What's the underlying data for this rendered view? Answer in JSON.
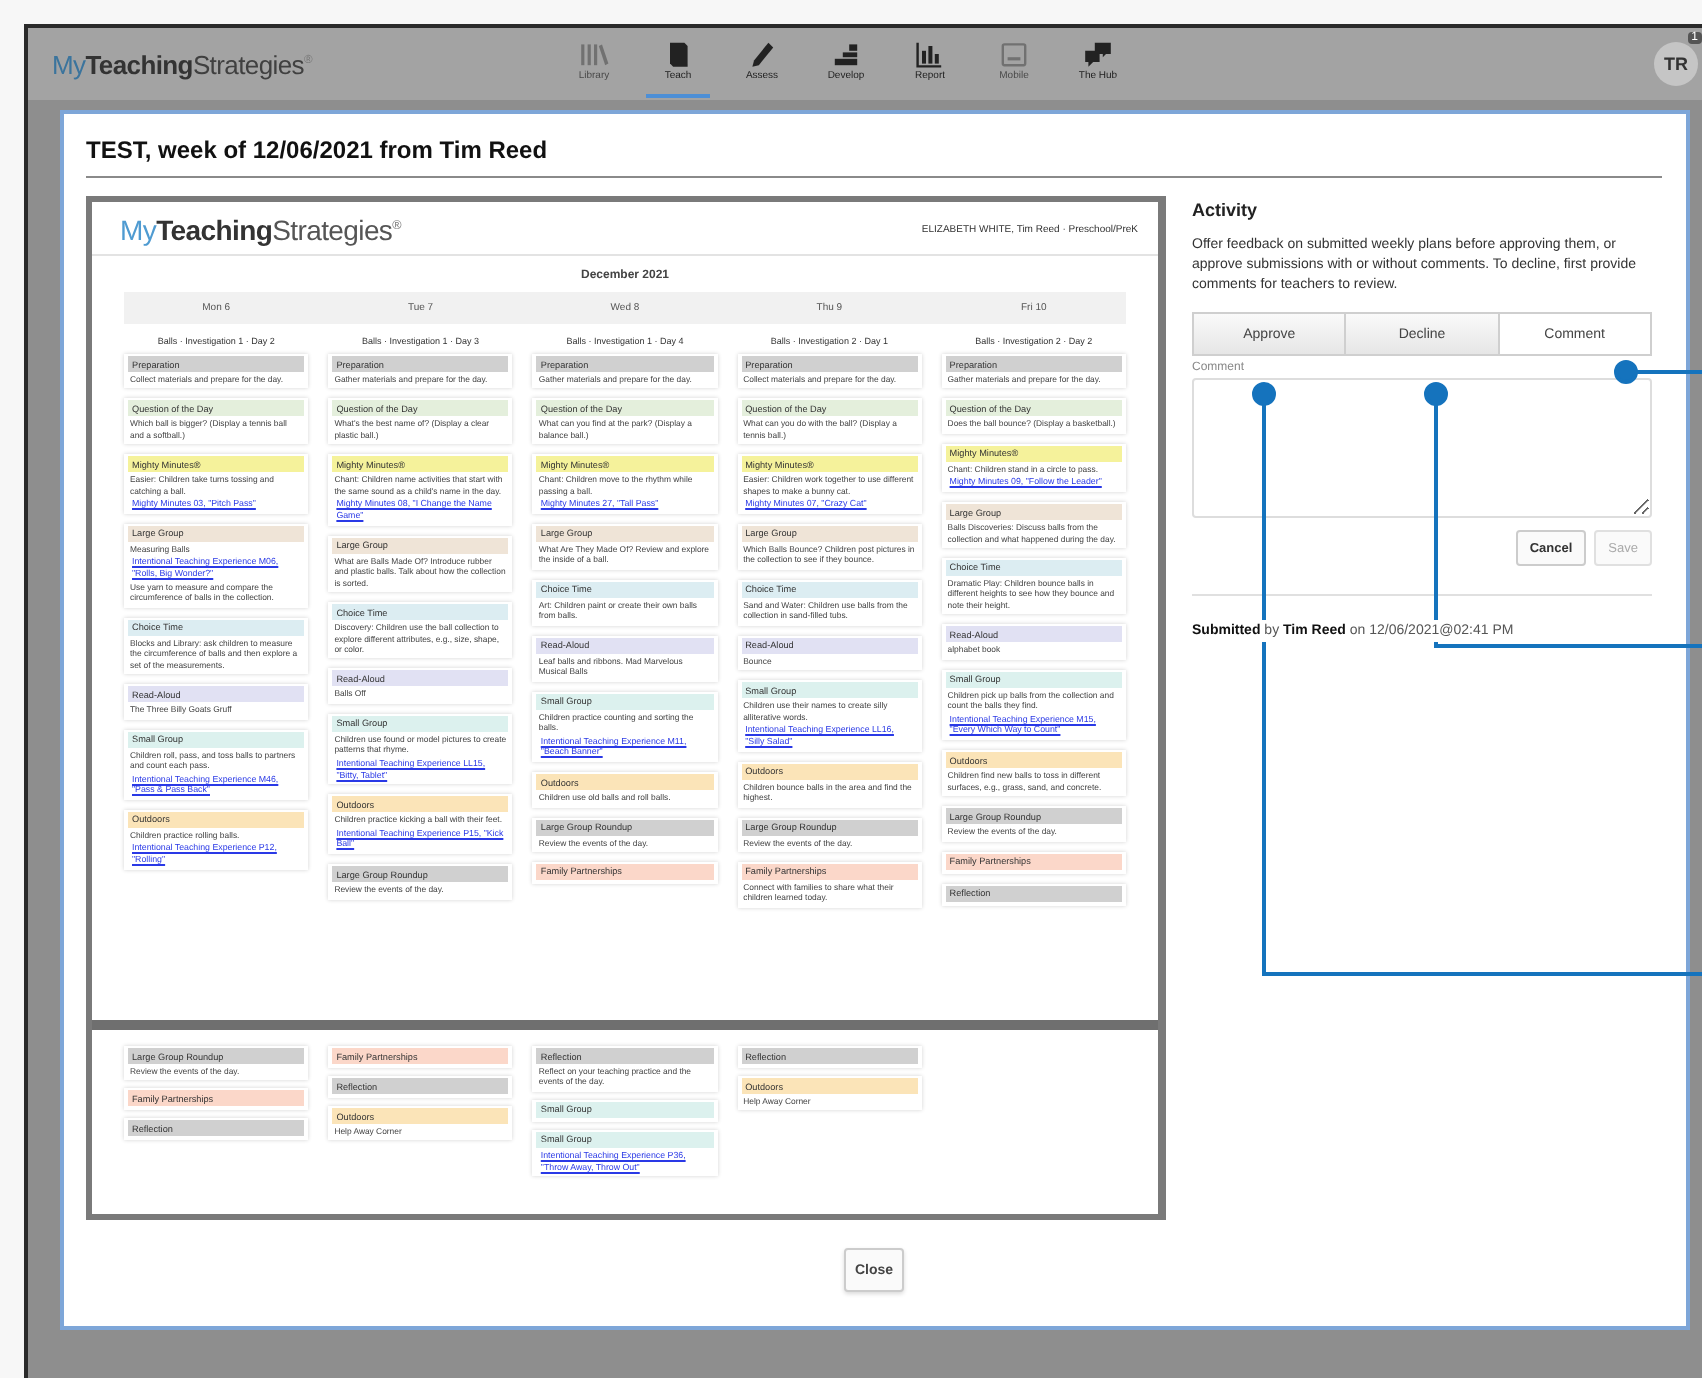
{
  "app_bar": {
    "logo": {
      "prefix": "My",
      "bold": "Teaching",
      "suffix": "Strategies",
      "mark": "®"
    },
    "nav": [
      {
        "label": "Library",
        "kind": "library",
        "selected": false,
        "disabled": true
      },
      {
        "label": "Teach",
        "kind": "teach",
        "selected": true,
        "disabled": false
      },
      {
        "label": "Assess",
        "kind": "assess",
        "selected": false,
        "disabled": false
      },
      {
        "label": "Develop",
        "kind": "develop",
        "selected": false,
        "disabled": false
      },
      {
        "label": "Report",
        "kind": "report",
        "selected": false,
        "disabled": false
      },
      {
        "label": "Mobile",
        "kind": "mobile",
        "selected": false,
        "disabled": true
      },
      {
        "label": "The Hub",
        "kind": "hub",
        "selected": false,
        "disabled": false
      }
    ],
    "avatar": "TR",
    "notification_count": "1"
  },
  "modal": {
    "title": "TEST, week of 12/06/2021 from Tim Reed",
    "document": {
      "logo": {
        "prefix": "My",
        "bold": "Teaching",
        "suffix": "Strategies",
        "mark": "®"
      },
      "byline": "ELIZABETH WHITE, Tim Reed · Preschool/PreK",
      "month": "December 2021",
      "days": [
        {
          "day": "Mon 6",
          "study": "Balls · Investigation 1 · Day 2",
          "sections": [
            {
              "title": "Preparation",
              "kind": "preparation",
              "text": "Collect materials and prepare for the day."
            },
            {
              "title": "Question of the Day",
              "kind": "question",
              "text": "Which ball is bigger? (Display a tennis ball and a softball.)"
            },
            {
              "title": "Mighty Minutes®",
              "kind": "mighty",
              "link": "Mighty Minutes 03, \"Pitch Pass\"",
              "text": "Easier: Children take turns tossing and catching a ball."
            },
            {
              "title": "Large Group",
              "kind": "large",
              "text": "Measuring Balls",
              "link": "Intentional Teaching Experience M06, \"Rolls, Big Wonder?\"",
              "note": "Use yarn to measure and compare the circumference of balls in the collection."
            },
            {
              "title": "Choice Time",
              "kind": "choice",
              "text": "Blocks and Library: ask children to measure the circumference of balls and then explore a set of the measurements."
            },
            {
              "title": "Read-Aloud",
              "kind": "read",
              "text": "The Three Billy Goats Gruff"
            },
            {
              "title": "Small Group",
              "kind": "small",
              "link": "Intentional Teaching Experience M46, \"Pass & Pass Back\"",
              "text": "Children roll, pass, and toss balls to partners and count each pass."
            },
            {
              "title": "Outdoors",
              "kind": "outdoors",
              "link": "Intentional Teaching Experience P12, \"Rolling\"",
              "text": "Children practice rolling balls."
            }
          ]
        },
        {
          "day": "Tue 7",
          "study": "Balls · Investigation 1 · Day 3",
          "sections": [
            {
              "title": "Preparation",
              "kind": "preparation",
              "text": "Gather materials and prepare for the day."
            },
            {
              "title": "Question of the Day",
              "kind": "question",
              "text": "What's the best name of? (Display a clear plastic ball.)"
            },
            {
              "title": "Mighty Minutes®",
              "kind": "mighty",
              "link": "Mighty Minutes 08, \"I Change the Name Game\"",
              "text": "Chant: Children name activities that start with the same sound as a child's name in the day."
            },
            {
              "title": "Large Group",
              "kind": "large",
              "text": "What are Balls Made Of? Introduce rubber and plastic balls. Talk about how the collection is sorted."
            },
            {
              "title": "Choice Time",
              "kind": "choice",
              "text": "Discovery: Children use the ball collection to explore different attributes, e.g., size, shape, or color."
            },
            {
              "title": "Read-Aloud",
              "kind": "read",
              "text": "Balls Off"
            },
            {
              "title": "Small Group",
              "kind": "small",
              "link": "Intentional Teaching Experience LL15, \"Bitty, Tablet\"",
              "text": "Children use found or model pictures to create patterns that rhyme."
            },
            {
              "title": "Outdoors",
              "kind": "outdoors",
              "link": "Intentional Teaching Experience P15, \"Kick Ball\"",
              "text": "Children practice kicking a ball with their feet."
            },
            {
              "title": "Large Group Roundup",
              "kind": "roundup",
              "text": "Review the events of the day."
            }
          ]
        },
        {
          "day": "Wed 8",
          "study": "Balls · Investigation 1 · Day 4",
          "sections": [
            {
              "title": "Preparation",
              "kind": "preparation",
              "text": "Gather materials and prepare for the day."
            },
            {
              "title": "Question of the Day",
              "kind": "question",
              "text": "What can you find at the park? (Display a balance ball.)"
            },
            {
              "title": "Mighty Minutes®",
              "kind": "mighty",
              "link": "Mighty Minutes 27, \"Tall Pass\"",
              "text": "Chant: Children move to the rhythm while passing a ball."
            },
            {
              "title": "Large Group",
              "kind": "large",
              "text": "What Are They Made Of? Review and explore the inside of a ball."
            },
            {
              "title": "Choice Time",
              "kind": "choice",
              "text": "Art: Children paint or create their own balls from balls."
            },
            {
              "title": "Read-Aloud",
              "kind": "read",
              "text": "Leaf balls and ribbons. Mad Marvelous Musical Balls"
            },
            {
              "title": "Small Group",
              "kind": "small",
              "link": "Intentional Teaching Experience M11, \"Beach Banner\"",
              "text": "Children practice counting and sorting the balls."
            },
            {
              "title": "Outdoors",
              "kind": "outdoors",
              "text": "Children use old balls and roll balls."
            },
            {
              "title": "Large Group Roundup",
              "kind": "roundup",
              "text": "Review the events of the day."
            },
            {
              "title": "Family Partnerships",
              "kind": "family"
            }
          ]
        },
        {
          "day": "Thu 9",
          "study": "Balls · Investigation 2 · Day 1",
          "sections": [
            {
              "title": "Preparation",
              "kind": "preparation",
              "text": "Collect materials and prepare for the day."
            },
            {
              "title": "Question of the Day",
              "kind": "question",
              "text": "What can you do with the ball? (Display a tennis ball.)"
            },
            {
              "title": "Mighty Minutes®",
              "kind": "mighty",
              "link": "Mighty Minutes 07, \"Crazy Cat\"",
              "text": "Easier: Children work together to use different shapes to make a bunny cat."
            },
            {
              "title": "Large Group",
              "kind": "large",
              "text": "Which Balls Bounce? Children post pictures in the collection to see if they bounce."
            },
            {
              "title": "Choice Time",
              "kind": "choice",
              "text": "Sand and Water: Children use balls from the collection in sand-filled tubs."
            },
            {
              "title": "Read-Aloud",
              "kind": "read",
              "text": "Bounce"
            },
            {
              "title": "Small Group",
              "kind": "small",
              "link": "Intentional Teaching Experience LL16, \"Silly Salad\"",
              "text": "Children use their names to create silly alliterative words."
            },
            {
              "title": "Outdoors",
              "kind": "outdoors",
              "text": "Children bounce balls in the area and find the highest."
            },
            {
              "title": "Large Group Roundup",
              "kind": "roundup",
              "text": "Review the events of the day."
            },
            {
              "title": "Family Partnerships",
              "kind": "family",
              "text": "Connect with families to share what their children learned today."
            }
          ]
        },
        {
          "day": "Fri 10",
          "study": "Balls · Investigation 2 · Day 2",
          "sections": [
            {
              "title": "Preparation",
              "kind": "preparation",
              "text": "Gather materials and prepare for the day."
            },
            {
              "title": "Question of the Day",
              "kind": "question",
              "text": "Does the ball bounce? (Display a basketball.)"
            },
            {
              "title": "Mighty Minutes®",
              "kind": "mighty",
              "link": "Mighty Minutes 09, \"Follow the Leader\"",
              "text": "Chant: Children stand in a circle to pass."
            },
            {
              "title": "Large Group",
              "kind": "large",
              "text": "Balls Discoveries: Discuss balls from the collection and what happened during the day."
            },
            {
              "title": "Choice Time",
              "kind": "choice",
              "text": "Dramatic Play: Children bounce balls in different heights to see how they bounce and note their height."
            },
            {
              "title": "Read-Aloud",
              "kind": "read",
              "text": "alphabet book"
            },
            {
              "title": "Small Group",
              "kind": "small",
              "link": "Intentional Teaching Experience M15, \"Every Which Way to Count\"",
              "text": "Children pick up balls from the collection and count the balls they find."
            },
            {
              "title": "Outdoors",
              "kind": "outdoors",
              "text": "Children find new balls to toss in different surfaces, e.g., grass, sand, and concrete."
            },
            {
              "title": "Large Group Roundup",
              "kind": "roundup",
              "text": "Review the events of the day."
            },
            {
              "title": "Family Partnerships",
              "kind": "family"
            },
            {
              "title": "Reflection",
              "kind": "reflection"
            }
          ]
        }
      ],
      "continued": [
        [
          {
            "title": "Large Group Roundup",
            "kind": "roundup",
            "text": "Review the events of the day."
          },
          {
            "title": "Family Partnerships",
            "kind": "family"
          },
          {
            "title": "Reflection",
            "kind": "reflection"
          }
        ],
        [
          {
            "title": "Family Partnerships",
            "kind": "family"
          },
          {
            "title": "Reflection",
            "kind": "reflection"
          },
          {
            "title": "Outdoors",
            "kind": "outdoors",
            "text": "Help Away Corner"
          }
        ],
        [
          {
            "title": "Reflection",
            "kind": "reflection",
            "text": "Reflect on your teaching practice and the events of the day."
          },
          {
            "title": "Small Group",
            "kind": "small"
          },
          {
            "title": "Small Group",
            "kind": "small",
            "link": "Intentional Teaching Experience P36, \"Throw Away, Throw Out\""
          }
        ],
        [
          {
            "title": "Reflection",
            "kind": "reflection"
          },
          {
            "title": "Outdoors",
            "kind": "outdoors",
            "text": "Help Away Corner"
          }
        ]
      ]
    },
    "activity": {
      "heading": "Activity",
      "description": "Offer feedback on submitted weekly plans before approving them, or approve submissions with or without comments. To decline, first provide comments for teachers to review.",
      "actions": [
        {
          "label": "Approve",
          "selected": false
        },
        {
          "label": "Decline",
          "selected": false
        },
        {
          "label": "Comment",
          "selected": true
        }
      ],
      "comment_label": "Comment",
      "buttons": [
        {
          "label": "Cancel",
          "disabled": false
        },
        {
          "label": "Save",
          "disabled": true
        }
      ],
      "submitted": "**Submitted** by **Tim Reed** on 12/06/2021@02:41 PM"
    },
    "close": "Close"
  }
}
